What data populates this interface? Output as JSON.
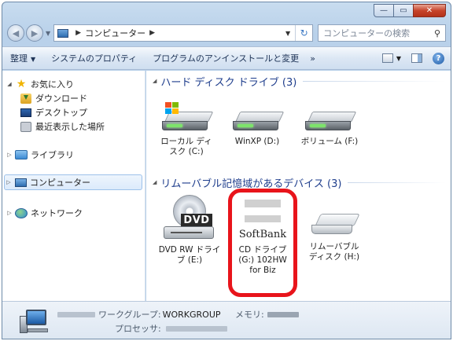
{
  "window": {
    "buttons": {
      "minimize": "—",
      "maximize": "▭",
      "close": "✕"
    }
  },
  "address_bar": {
    "path": [
      "コンピューター"
    ],
    "search_placeholder": "コンピューターの検索"
  },
  "command_bar": {
    "organize": "整理",
    "system_properties": "システムのプロパティ",
    "uninstall": "プログラムのアンインストールと変更",
    "more": "»"
  },
  "nav_pane": {
    "favorites": "お気に入り",
    "favorites_items": [
      "ダウンロード",
      "デスクトップ",
      "最近表示した場所"
    ],
    "libraries": "ライブラリ",
    "computer": "コンピューター",
    "network": "ネットワーク"
  },
  "content": {
    "hdd_group": "ハード ディスク ドライブ (3)",
    "hdd_items": [
      {
        "label": "ローカル ディスク (C:)",
        "icon": "windows-drive"
      },
      {
        "label": "WinXP (D:)",
        "icon": "drive"
      },
      {
        "label": "ボリューム (F:)",
        "icon": "drive"
      }
    ],
    "removable_group": "リムーバブル記憶域があるデバイス (3)",
    "removable_items": [
      {
        "label": "DVD RW ドライブ (E:)",
        "icon": "dvd-drive",
        "badge": "DVD"
      },
      {
        "label": "CD ドライブ (G:) 102HW for Biz",
        "icon": "softbank-cd",
        "brand": "SoftBank"
      },
      {
        "label": "リムーバブル ディスク (H:)",
        "icon": "removable-drive"
      }
    ]
  },
  "details_pane": {
    "workgroup_label": "ワークグループ:",
    "workgroup_value": "WORKGROUP",
    "memory_label": "メモリ:",
    "processor_label": "プロセッサ:"
  },
  "colors": {
    "highlight_box": "#e8141b",
    "group_title": "#1e3d8c",
    "selected_nav": "#dceafb"
  }
}
